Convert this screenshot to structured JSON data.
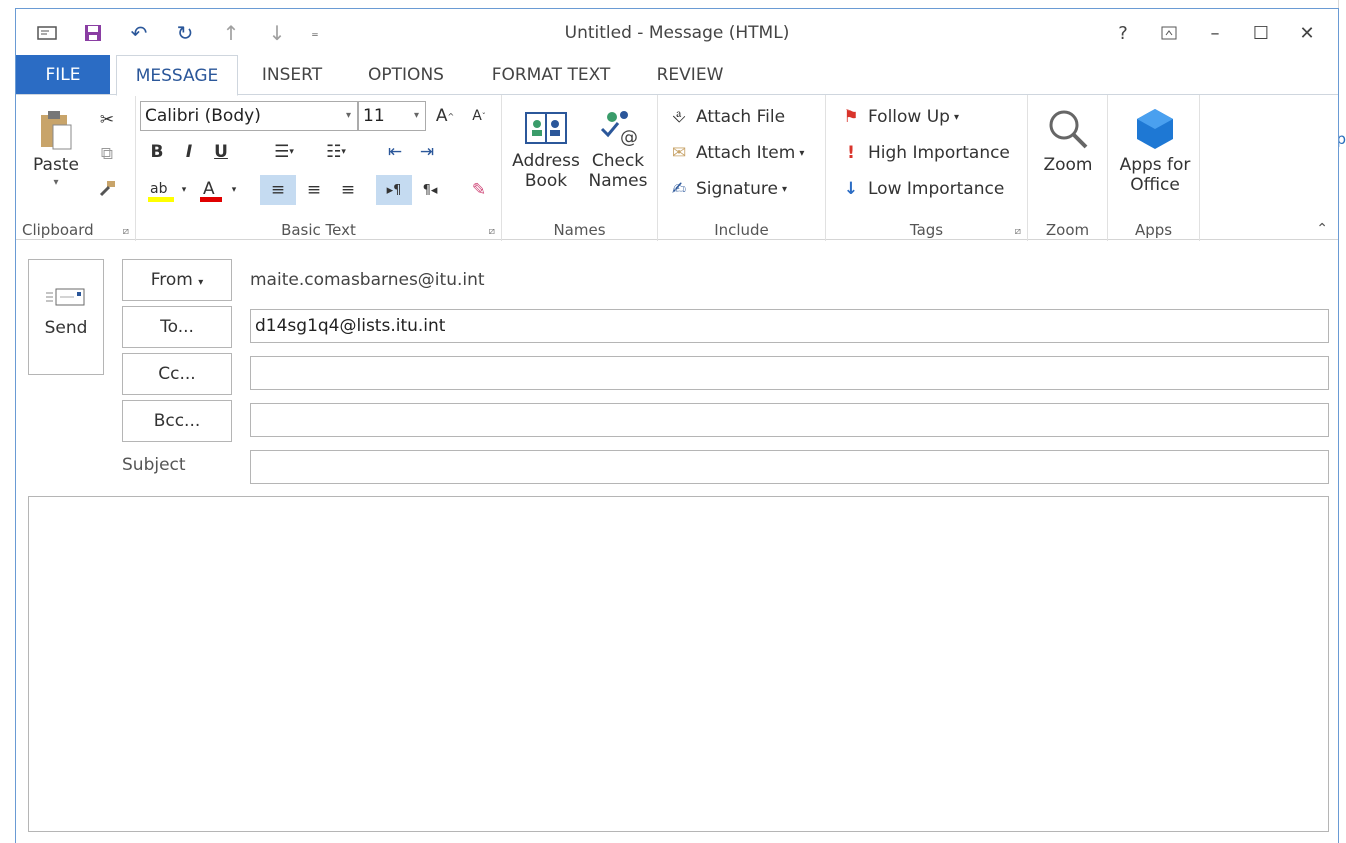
{
  "window": {
    "title": "Untitled - Message (HTML)"
  },
  "qat": [
    {
      "name": "new-message-icon"
    },
    {
      "name": "save-icon"
    },
    {
      "name": "undo-icon"
    },
    {
      "name": "redo-icon"
    },
    {
      "name": "previous-item-icon"
    },
    {
      "name": "next-item-icon"
    },
    {
      "name": "customize-qat-icon"
    }
  ],
  "window_controls": {
    "help": "?",
    "ribbon_options": "⊼",
    "minimize": "–",
    "maximize": "☐",
    "close": "✕"
  },
  "tabs": [
    "FILE",
    "MESSAGE",
    "INSERT",
    "OPTIONS",
    "FORMAT TEXT",
    "REVIEW"
  ],
  "active_tab": "MESSAGE",
  "ribbon": {
    "clipboard": {
      "label": "Clipboard",
      "paste": "Paste"
    },
    "basic_text": {
      "label": "Basic Text",
      "font": "Calibri (Body)",
      "size": "11",
      "bold": "B",
      "italic": "I",
      "underline": "U"
    },
    "names": {
      "label": "Names",
      "address_book_1": "Address",
      "address_book_2": "Book",
      "check_names_1": "Check",
      "check_names_2": "Names"
    },
    "include": {
      "label": "Include",
      "attach_file": "Attach File",
      "attach_item": "Attach Item",
      "signature": "Signature"
    },
    "tags": {
      "label": "Tags",
      "follow_up": "Follow Up",
      "high_importance": "High Importance",
      "low_importance": "Low Importance"
    },
    "zoom": {
      "label": "Zoom",
      "zoom_btn": "Zoom"
    },
    "apps": {
      "label": "Apps",
      "apps_1": "Apps for",
      "apps_2": "Office"
    }
  },
  "compose": {
    "send": "Send",
    "from_label": "From",
    "from_value": "maite.comasbarnes@itu.int",
    "to_label": "To...",
    "to_value": "d14sg1q4@lists.itu.int",
    "cc_label": "Cc...",
    "cc_value": "",
    "bcc_label": "Bcc...",
    "bcc_value": "",
    "subject_label": "Subject",
    "subject_value": ""
  },
  "colors": {
    "accent": "#2b579a",
    "file_tab": "#2b6cc4",
    "highlight": "#c5dbf1",
    "border": "#6a9bd4"
  }
}
